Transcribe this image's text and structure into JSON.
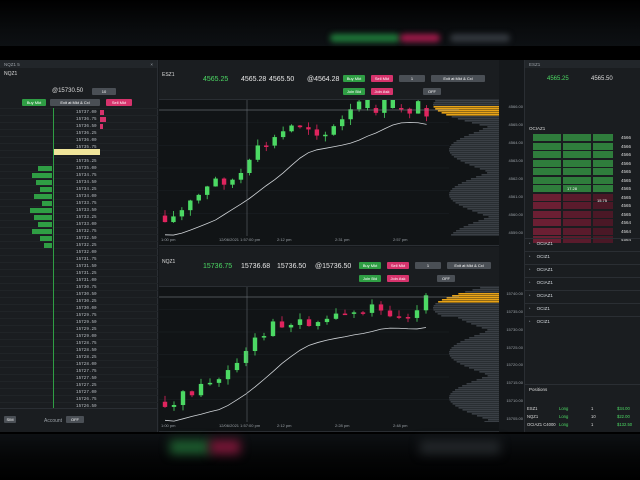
{
  "ladder": {
    "tab_label": "NQZ1 5",
    "symbol": "NQZ1",
    "last_price": "@15730.50",
    "qty": "10",
    "buy_label": "Buy Mkt",
    "sell_label": "Sell Mkt",
    "exit_label": "Exit at Mkt & Cxl",
    "prices": [
      "15737.00",
      "15736.75",
      "15736.50",
      "15736.25",
      "15736.00",
      "15735.75",
      "15735.50",
      "15735.25",
      "15735.00",
      "15734.75",
      "15734.50",
      "15734.25",
      "15734.00",
      "15733.75",
      "15733.50",
      "15733.25",
      "15733.00",
      "15732.75",
      "15732.50",
      "15732.25",
      "15732.00",
      "15731.75",
      "15731.50",
      "15731.25",
      "15731.00",
      "15730.75",
      "15730.50",
      "15730.25",
      "15730.00",
      "15729.75",
      "15729.50",
      "15729.25",
      "15729.00",
      "15728.75",
      "15728.50",
      "15728.25",
      "15728.00",
      "15727.75",
      "15727.50",
      "15727.25",
      "15727.00",
      "15726.75",
      "15726.50"
    ],
    "account_label": "Account",
    "account_value": "OFF",
    "foot_left": "SIM"
  },
  "chart_es": {
    "tab_label": "ESZ1 3",
    "symbol": "ESZ1",
    "quotes": [
      "4565.25",
      "4565.28",
      "4565.50",
      "@4564.28"
    ],
    "qty": "1",
    "buy_label": "Buy Mkt",
    "sell_label": "Sell Mkt",
    "buy_ask_label": "Join Bid",
    "sell_bid_label": "Join Ask",
    "exit_label": "Exit at Mkt & Cxl",
    "off_label": "OFF",
    "x_ticks": [
      "1:00 pm",
      "12/06/2021 1:57:00 pm",
      "2:12 pm",
      "2:31 pm",
      "2:57 pm"
    ],
    "y_ticks": [
      "4566.00",
      "4565.00",
      "4564.00",
      "4563.00",
      "4562.00",
      "4561.00",
      "4560.00",
      "4559.00"
    ]
  },
  "chart_nq": {
    "tab_label": "NQZ1 3",
    "symbol": "NQZ1",
    "quotes": [
      "15736.75",
      "15736.68",
      "15736.50",
      "@15736.50"
    ],
    "qty": "1",
    "buy_label": "Buy Mkt",
    "sell_label": "Sell Mkt",
    "buy_ask_label": "Join Bid",
    "sell_bid_label": "Join Ask",
    "exit_label": "Exit at Mkt & Cxl",
    "off_label": "OFF",
    "x_ticks": [
      "1:00 pm",
      "12/06/2021 1:57:00 pm",
      "2:12 pm",
      "2:28 pm",
      "2:48 pm"
    ],
    "y_ticks": [
      "15740.00",
      "15735.00",
      "15730.00",
      "15725.00",
      "15720.00",
      "15715.00",
      "15710.00",
      "15705.00"
    ]
  },
  "right": {
    "symbol": "ESZ1",
    "quote_a": "4565.25",
    "quote_b": "4565.50",
    "section": "OCIAZ1",
    "order_prices": [
      "4566",
      "4566",
      "4566",
      "4566",
      "4565",
      "4565",
      "4565",
      "4565",
      "4565",
      "4565",
      "4564",
      "4564",
      "4564"
    ],
    "mid_value": "17.28",
    "side_value": "15.75",
    "order_tabs": [
      "OCIAZ1",
      "OCIZ1",
      "OCIAZ1",
      "OCIAZ1",
      "OCIAZ1",
      "OCIZ1",
      "OCIZ1"
    ],
    "positions_title": "Positions",
    "positions": [
      {
        "sym": "ESZ1",
        "side": "Long",
        "qty": "1",
        "pnl": "$34.00"
      },
      {
        "sym": "NQZ1",
        "side": "Long",
        "qty": "10",
        "pnl": "$22.00"
      },
      {
        "sym": "OCIAZ1 C4000",
        "side": "Long",
        "qty": "1",
        "pnl": "$132.50"
      }
    ]
  },
  "colors": {
    "up": "#4cd964",
    "down": "#e0245e",
    "bg": "#111416"
  }
}
